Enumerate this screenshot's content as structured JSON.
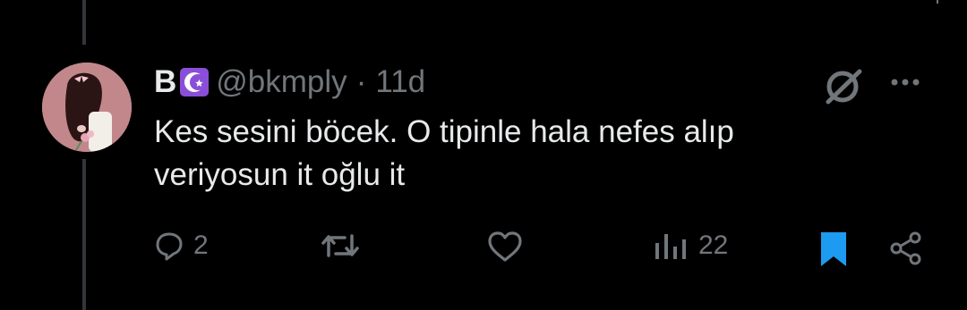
{
  "tweet": {
    "display_name": "B",
    "badge_icon": "star-and-crescent-icon",
    "handle": "@bkmply",
    "separator": "·",
    "time": "11d",
    "text_line1": "Kes sesini böcek. O tipinle hala nefes alıp",
    "text_line2": "veriyosun it oğlu it"
  },
  "actions": {
    "reply_count": "2",
    "repost_count": "",
    "like_count": "",
    "views_count": "22"
  },
  "colors": {
    "background": "#000000",
    "text": "#e7e9ea",
    "muted": "#71767b",
    "bookmark_active": "#1d9bf0",
    "badge_purple": "#8a4fd8"
  }
}
